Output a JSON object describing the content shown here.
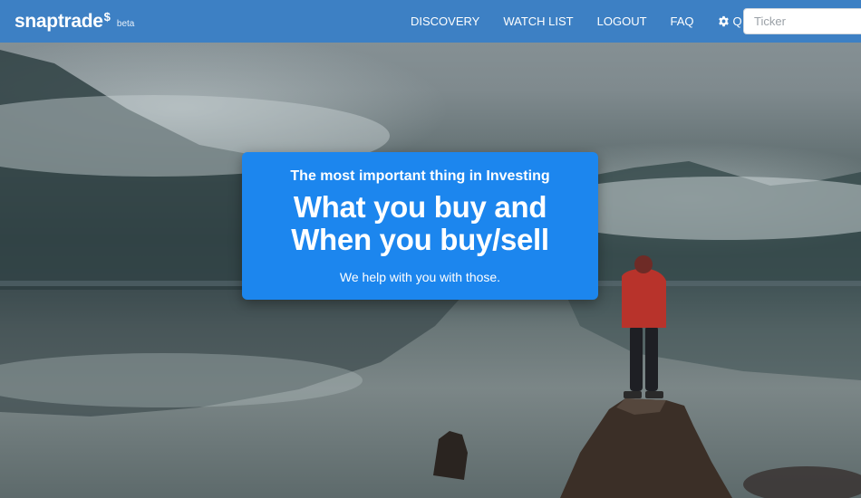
{
  "brand": {
    "name": "snaptrade",
    "superscript": "$",
    "tag": "beta"
  },
  "nav": {
    "items": [
      {
        "label": "DISCOVERY"
      },
      {
        "label": "WATCH LIST"
      },
      {
        "label": "LOGOUT"
      },
      {
        "label": "FAQ"
      }
    ],
    "settings": {
      "icon": "gear-icon",
      "label": "Q"
    }
  },
  "search": {
    "value": "",
    "placeholder": "Ticker"
  },
  "hero": {
    "kicker": "The most important thing in Investing",
    "headline_line1": "What you buy and",
    "headline_line2": "When you buy/sell",
    "subtext": "We help with you with those."
  },
  "colors": {
    "navbar": "#3d80c4",
    "callout": "#1c86ee",
    "text_on_blue": "#ffffff"
  }
}
